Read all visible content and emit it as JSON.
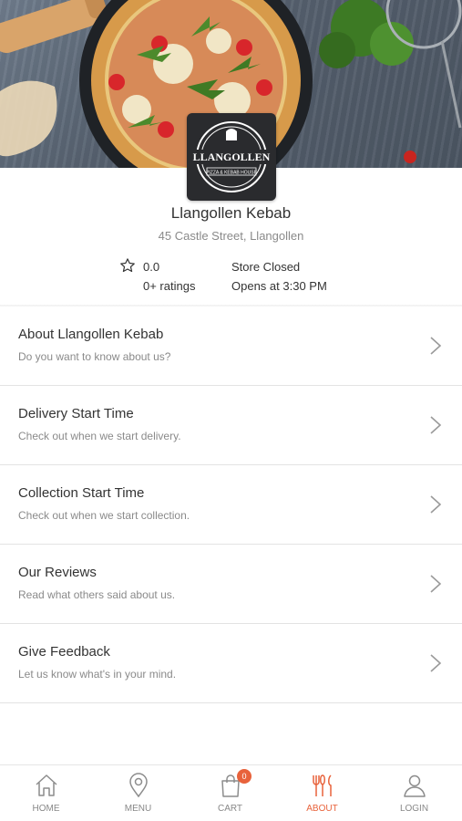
{
  "store": {
    "name": "Llangollen Kebab",
    "address": "45 Castle Street, Llangollen",
    "logo_text": "LLANGOLLEN",
    "logo_subtext": "PIZZA & KEBAB HOUSE"
  },
  "stats": {
    "rating": "0.0",
    "ratings_count": "0+ ratings",
    "status": "Store Closed",
    "opens_at": "Opens at 3:30 PM"
  },
  "menu": {
    "items": [
      {
        "title": "About Llangollen Kebab",
        "subtitle": "Do you want to know about us?"
      },
      {
        "title": "Delivery Start Time",
        "subtitle": "Check out when we start delivery."
      },
      {
        "title": "Collection Start Time",
        "subtitle": "Check out when we start collection."
      },
      {
        "title": "Our Reviews",
        "subtitle": "Read what others said about us."
      },
      {
        "title": "Give Feedback",
        "subtitle": "Let us know what's in your mind."
      }
    ]
  },
  "tabbar": {
    "home": "HOME",
    "menu": "MENU",
    "cart": "CART",
    "cart_count": "0",
    "about": "ABOUT",
    "login": "LOGIN"
  },
  "colors": {
    "accent": "#e8623b",
    "text": "#333333",
    "muted": "#8a8a8a"
  }
}
